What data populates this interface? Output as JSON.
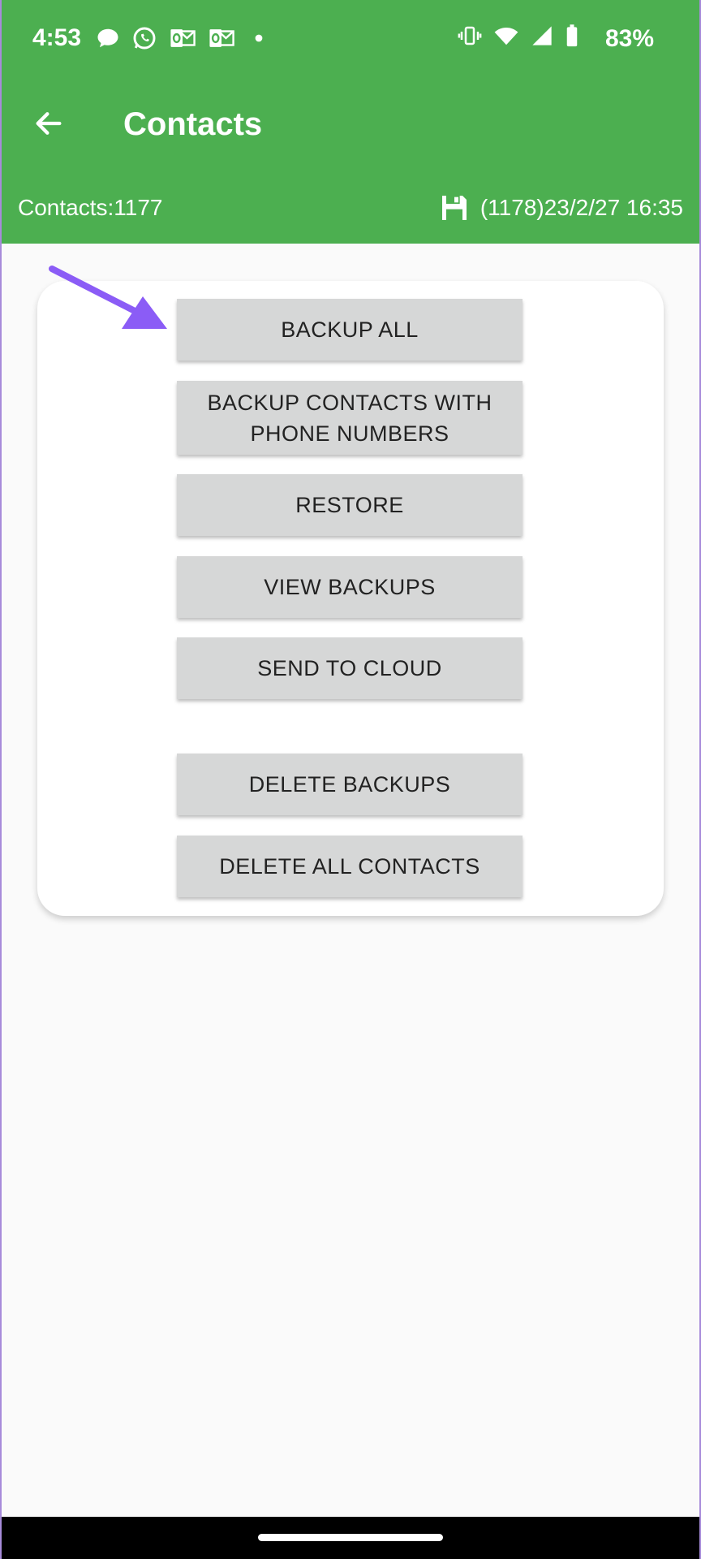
{
  "status_bar": {
    "time": "4:53",
    "battery": "83%",
    "icons_left": [
      "chat-bubble-icon",
      "whatsapp-icon",
      "outlook-icon",
      "outlook-icon",
      "dot-icon"
    ],
    "icons_right": [
      "vibrate-icon",
      "wifi-icon",
      "signal-icon",
      "battery-icon"
    ]
  },
  "app_bar": {
    "title": "Contacts",
    "back_icon": "arrow-back-icon"
  },
  "info_bar": {
    "contacts_count": "Contacts:1177",
    "last_backup": "(1178)23/2/27 16:35",
    "backup_icon": "floppy-disk-icon"
  },
  "buttons": {
    "backup_all": "BACKUP ALL",
    "backup_phone_line1": "BACKUP CONTACTS WITH",
    "backup_phone_line2": "PHONE NUMBERS",
    "restore": "RESTORE",
    "view_backups": "VIEW BACKUPS",
    "send_to_cloud": "SEND TO CLOUD",
    "delete_backups": "DELETE BACKUPS",
    "delete_all_contacts": "DELETE ALL CONTACTS"
  },
  "colors": {
    "accent": "#4caf50",
    "button_bg": "#d6d7d7",
    "annotation_arrow": "#8b5cf6"
  }
}
